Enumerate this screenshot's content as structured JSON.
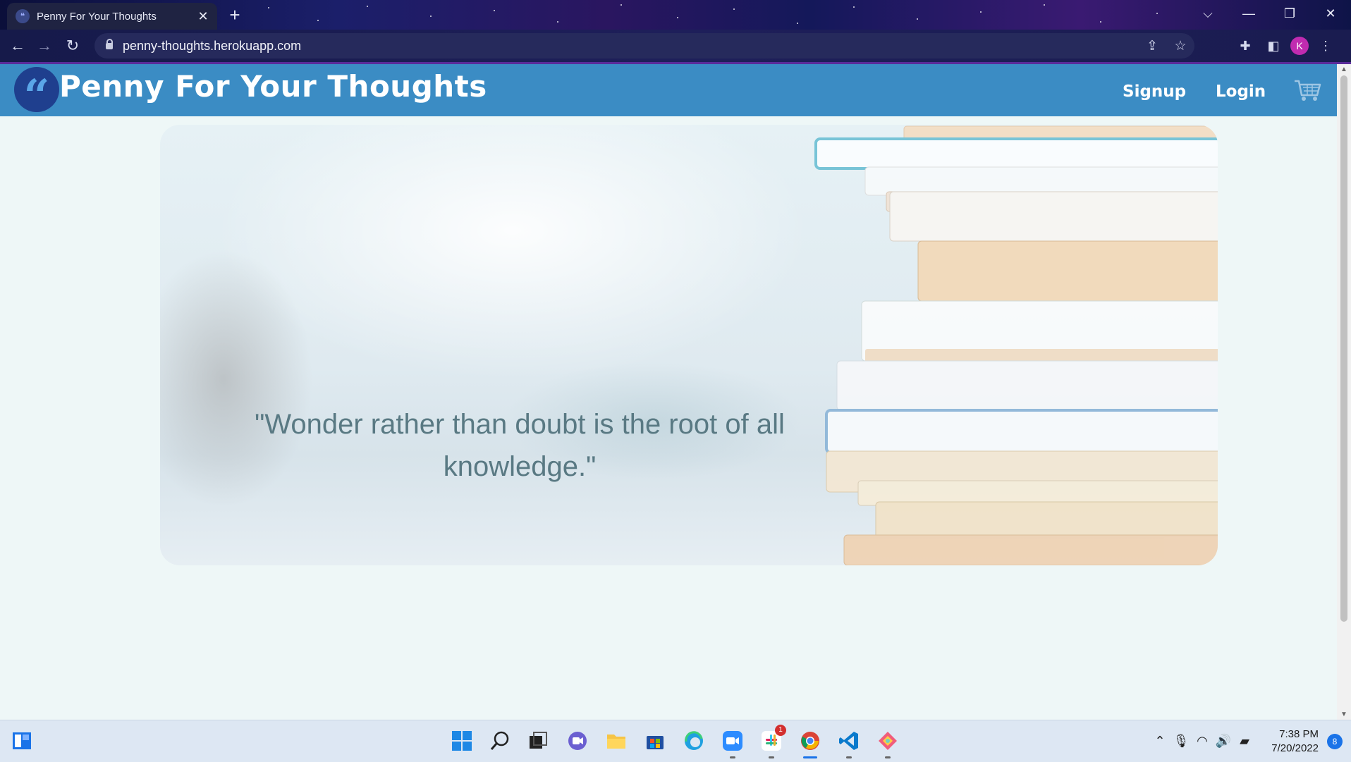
{
  "browser": {
    "tab_title": "Penny For Your Thoughts",
    "tab_close": "✕",
    "new_tab": "+",
    "url": "penny-thoughts.herokuapp.com",
    "profile_initial": "K",
    "window_controls": {
      "dropdown": "⌵",
      "minimize": "—",
      "restore": "❐",
      "close": "✕"
    }
  },
  "site": {
    "logo_glyph": "“",
    "title": "Penny For Your Thoughts",
    "nav": {
      "signup": "Signup",
      "login": "Login"
    }
  },
  "hero": {
    "quote": "\"Wonder rather than doubt is the root of all knowledge.\""
  },
  "taskbar": {
    "time": "7:38 PM",
    "date": "7/20/2022",
    "notification_count": "8",
    "teams_badge": "1"
  },
  "colors": {
    "header": "#3b8cc4",
    "logo": "#1f3f8e",
    "quote": "#597983",
    "page_bg": "#eef7f7"
  }
}
